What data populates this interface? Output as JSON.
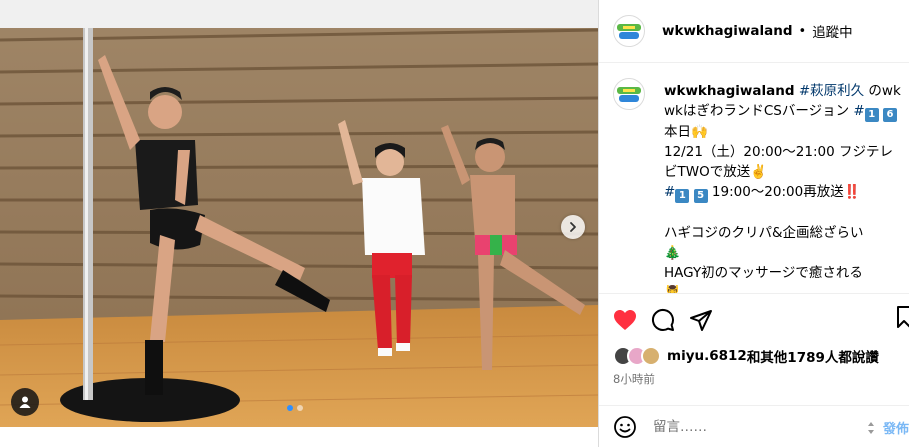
{
  "post": {
    "media": {
      "image_alt": "Three men dancing in a studio with a pole",
      "carousel": {
        "count": 2,
        "active_index": 0
      },
      "icons": {
        "next": "chevron-right-icon",
        "tag": "user-tag-icon"
      }
    },
    "header": {
      "username": "wkwkhagiwaland",
      "separator": "•",
      "follow_status": "追蹤中"
    },
    "caption": {
      "username": "wkwkhagiwaland",
      "hashtag": "#萩原利久",
      "line1_rest": " のwkwkはぎわランドCSバージョン ",
      "hash2": "#",
      "key_1": "1",
      "key_6": "6",
      "line2": "本日🙌",
      "line3": "12/21（土）20:00～21:00 フジテレビTWOで放送✌️",
      "hash3": "#",
      "key_1b": "1",
      "key_5": "5",
      "line4_rest": " 19:00～20:00再放送‼️",
      "line5": "ハギコジのクリパ&企画総ざらい",
      "line6": "🎄",
      "line7": "HAGY初のマッサージで癒される",
      "line8": "💆‍♂️"
    },
    "actions": {
      "like_icon": "heart-icon",
      "comment_icon": "comment-icon",
      "share_icon": "share-icon",
      "save_icon": "bookmark-icon"
    },
    "likes": {
      "liker": "miyu.6812",
      "rest": "和其他1789人都說讚"
    },
    "time": "8小時前",
    "comment": {
      "placeholder": "留言……",
      "post_label": "發佈"
    },
    "colors": {
      "like_red": "#ff3040",
      "link_blue": "#00376b",
      "post_blue": "#7ab8f5"
    }
  }
}
